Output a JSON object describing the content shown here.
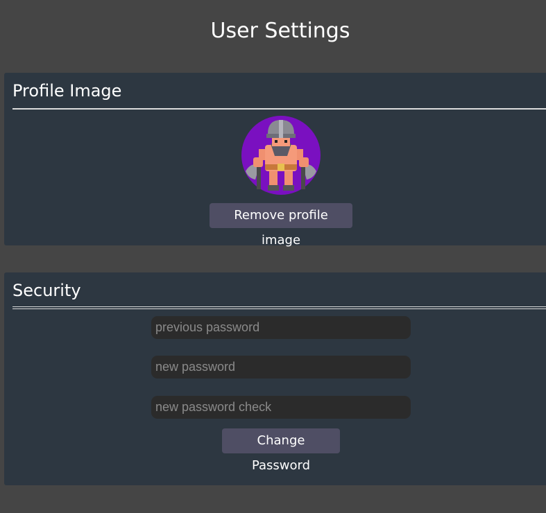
{
  "page": {
    "title": "User Settings"
  },
  "profile_section": {
    "heading": "Profile Image",
    "avatar_icon": "warrior-avatar-icon",
    "avatar_background": "#7a10c0",
    "remove_button_label": "Remove profile image"
  },
  "security_section": {
    "heading": "Security",
    "previous_password": {
      "value": "",
      "placeholder": "previous password"
    },
    "new_password": {
      "value": "",
      "placeholder": "new password"
    },
    "new_password_check": {
      "value": "",
      "placeholder": "new password check"
    },
    "change_button_label": "Change Password"
  },
  "colors": {
    "page_background": "#454545",
    "panel_background": "#2d3741",
    "button_background": "#4f4e64",
    "input_background": "#2b2b2b"
  }
}
